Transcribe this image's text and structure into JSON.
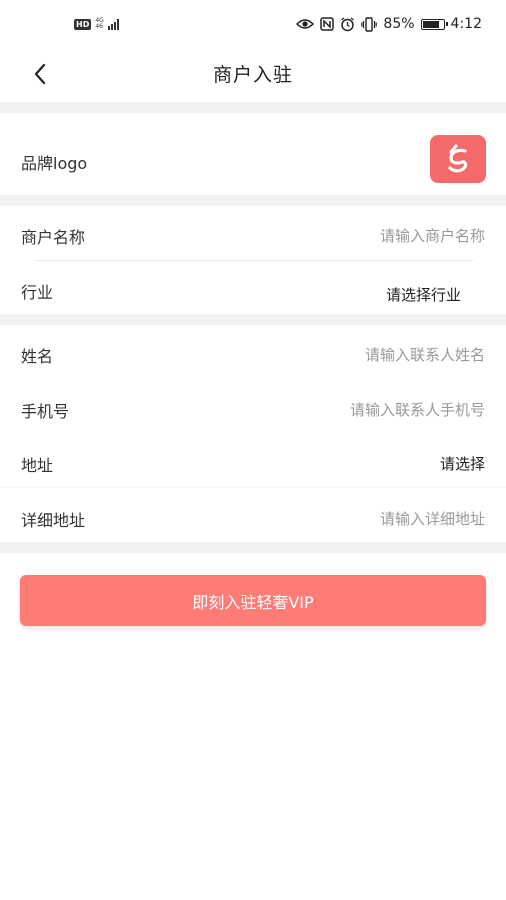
{
  "status_bar": {
    "hd": "HD",
    "net_top": "4G",
    "net_bottom": "46",
    "battery_level": 0.85,
    "battery_percent": "85%",
    "time": "4:12",
    "icons": [
      "eye-icon",
      "nfc-icon",
      "alarm-icon",
      "vibrate-icon"
    ]
  },
  "header": {
    "title": "商户入驻"
  },
  "brand": {
    "label": "品牌logo",
    "logo_color": "#f46a6a"
  },
  "merchant": {
    "name_label": "商户名称",
    "name_placeholder": "请输入商户名称",
    "industry_label": "行业",
    "industry_value": "请选择行业"
  },
  "contact": {
    "name_label": "姓名",
    "name_placeholder": "请输入联系人姓名",
    "phone_label": "手机号",
    "phone_placeholder": "请输入联系人手机号",
    "address_label": "地址",
    "address_value": "请选择",
    "detail_label": "详细地址",
    "detail_placeholder": "请输入详细地址"
  },
  "submit": {
    "label": "即刻入驻轻奢VIP",
    "color": "#ff7b76"
  }
}
